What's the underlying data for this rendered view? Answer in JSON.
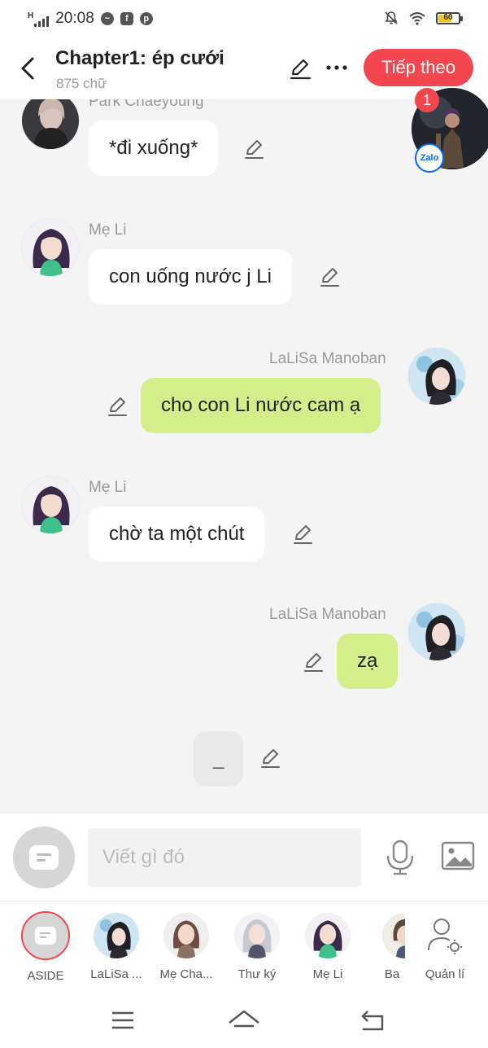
{
  "status_bar": {
    "network": "H",
    "time": "20:08",
    "notification_icons": [
      "messenger-icon",
      "facebook-icon",
      "pinterest-icon"
    ],
    "battery": "60",
    "battery_level": 0.6
  },
  "header": {
    "title": "Chapter1: ép cưới",
    "subtitle": "875 chữ",
    "next_label": "Tiếp theo"
  },
  "floating_bubble": {
    "badge": "1",
    "app_label": "Zalo"
  },
  "messages": [
    {
      "sender": "Park Chaeyoung",
      "text": "*đi xuống*",
      "side": "left"
    },
    {
      "sender": "Mẹ Li",
      "text": "con uống nước j Li",
      "side": "left"
    },
    {
      "sender": "LaLiSa Manoban",
      "text": "cho con Li nước cam ạ",
      "side": "right"
    },
    {
      "sender": "Mẹ Li",
      "text": "chờ ta một chút",
      "side": "left"
    },
    {
      "sender": "LaLiSa Manoban",
      "text": "zạ",
      "side": "right"
    },
    {
      "sender": "",
      "text": "_",
      "side": "center"
    }
  ],
  "input": {
    "placeholder": "Viết gì đó"
  },
  "characters": [
    {
      "label": "ASIDE"
    },
    {
      "label": "LaLiSa ..."
    },
    {
      "label": "Mẹ Cha..."
    },
    {
      "label": "Thư ký"
    },
    {
      "label": "Mẹ Li"
    },
    {
      "label": "Ba"
    },
    {
      "label": "Quản lí"
    }
  ],
  "colors": {
    "accent": "#f2474f",
    "own_bubble": "#d3ee8a",
    "other_bubble": "#ffffff",
    "background": "#f4f4f4"
  }
}
